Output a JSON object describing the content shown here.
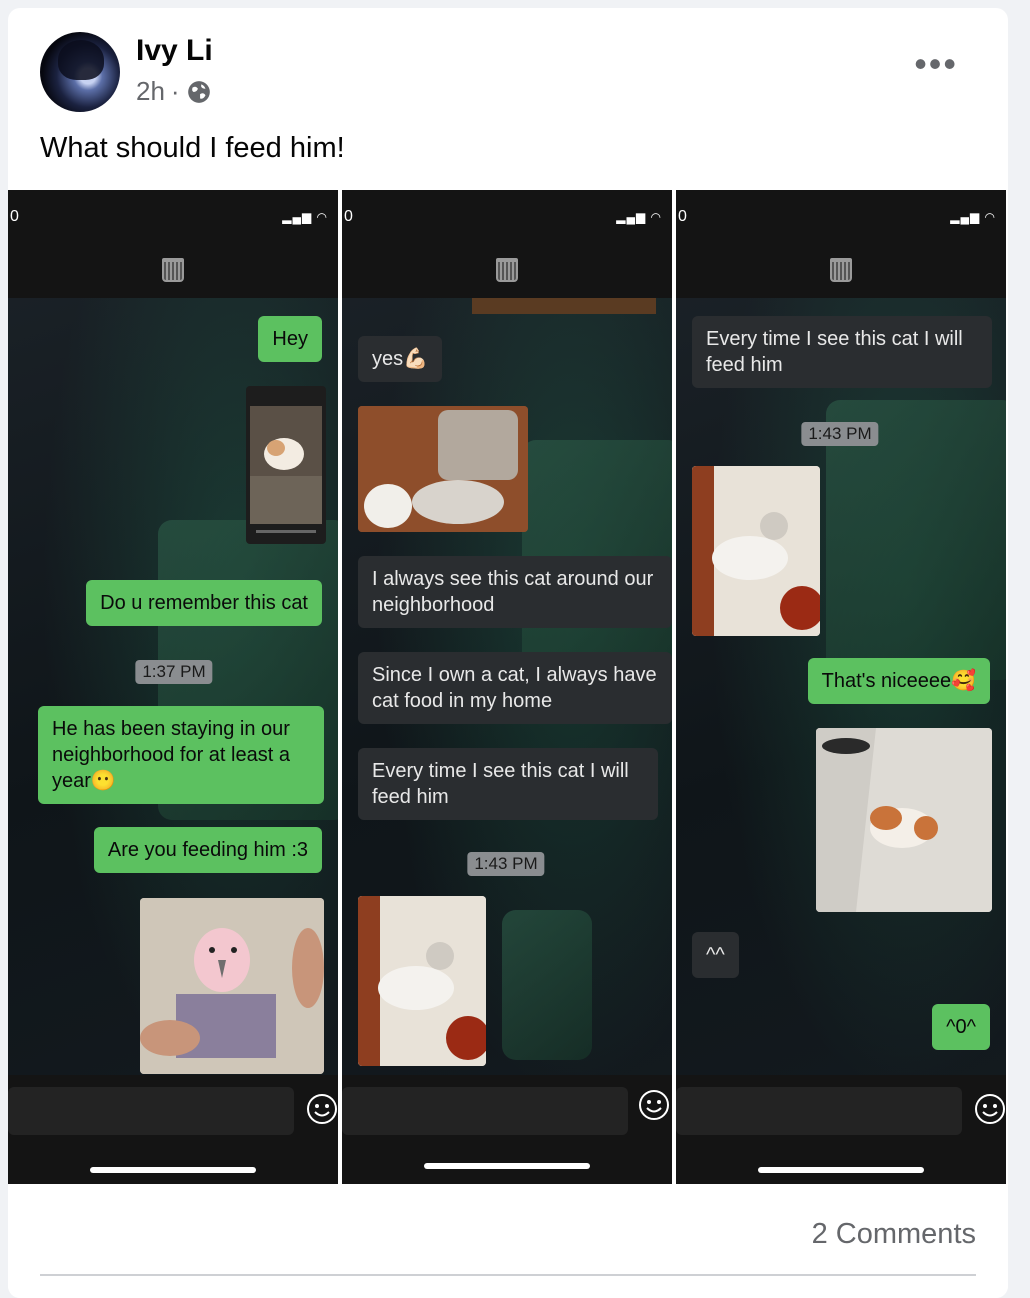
{
  "post": {
    "author": "Ivy Li",
    "time": "2h",
    "separator": "·",
    "text": "What should I feed him!",
    "comments": "2 Comments"
  },
  "phones": [
    {
      "status_left": "0",
      "messages": {
        "hey": "Hey",
        "remember": "Do u remember this cat",
        "time1": "1:37 PM",
        "staying": "He has been staying in our neighborhood for at least a year😶",
        "feeding": "Are you feeding him :3"
      }
    },
    {
      "status_left": "0",
      "messages": {
        "yes": "yes💪🏻",
        "always": "I always see this cat around our neighborhood",
        "since": "Since I own a cat, I always have cat food in my home",
        "every": "Every time I see this cat I will feed him",
        "time1": "1:43 PM"
      }
    },
    {
      "status_left": "0",
      "messages": {
        "every": "Every time I see this cat I will feed him",
        "time1": "1:43 PM",
        "nice": "That's niceeee🥰",
        "caret": "^^",
        "zero": "^0^"
      }
    }
  ],
  "colors": {
    "bubble_green": "#5cc160",
    "bubble_grey": "#2a2d30",
    "meta_grey": "#65676b"
  },
  "icons": [
    "avatar",
    "globe-icon",
    "more-icon",
    "trash-icon",
    "smiley-icon"
  ]
}
